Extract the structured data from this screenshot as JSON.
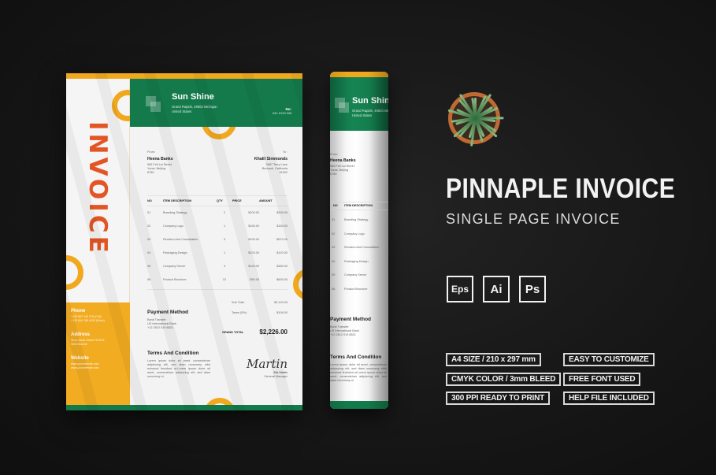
{
  "product": {
    "title": "PINNAPLE INVOICE",
    "subtitle": "SINGLE PAGE INVOICE",
    "file_formats": [
      "Eps",
      "Ai",
      "Ps"
    ],
    "features_left": [
      "A4 SIZE / 210 x 297 mm",
      "CMYK COLOR / 3mm BLEED",
      "300 PPI READY TO PRINT"
    ],
    "features_right": [
      "EASY TO CUSTOMIZE",
      "FREE FONT USED",
      "HELP FILE INCLUDED"
    ]
  },
  "colors": {
    "green": "#147a4c",
    "yellow": "#f2ac22",
    "orange": "#e35524",
    "background": "#161616"
  },
  "invoice": {
    "vertical_title": "INVOICE",
    "company": "Sun Shine",
    "company_address": [
      "Grand Rapids, 49503 Michigan",
      "United States"
    ],
    "invoice_no_label": "No:",
    "invoice_no": "INV. 8749 938",
    "from_label": "From:",
    "from_name": "Heena Banks",
    "from_address": [
      "565 Fell Lai Street",
      "Yunai, Beijing",
      "6780"
    ],
    "to_label": "To :",
    "to_name": "Khalil Simmonds",
    "to_address": [
      "3587 Terry Lane",
      "Burbank, California",
      "91502"
    ],
    "table": {
      "headers": [
        "NO",
        "ITEM DESCRIPTION",
        "QTY",
        "PRICE",
        "AMOUNT"
      ],
      "rows": [
        [
          "01",
          "Branding Strategy",
          "2",
          "$100.00",
          "$200.00"
        ],
        [
          "02",
          "Company Logo",
          "1",
          "$150.00",
          "$150.00"
        ],
        [
          "03",
          "Revision And Consultation",
          "3",
          "$190.00",
          "$570.00"
        ],
        [
          "04",
          "Packaging Design",
          "1",
          "$120.00",
          "$120.00"
        ],
        [
          "05",
          "Company Server",
          "4",
          "$120.00",
          "$480.00"
        ],
        [
          "06",
          "Product Brochure",
          "12",
          "$50.00",
          "$600.00"
        ]
      ]
    },
    "sub_total_label": "Sub Total",
    "sub_total": "$2,120.00",
    "taxes_label": "Taxes (5%)",
    "taxes": "$106.00",
    "grand_total_label": "GRAND TOTAL",
    "grand_total": "$2,226.00",
    "payment_title": "Payment Method",
    "payment_lines": [
      "Bank Transfer",
      "US International Bank",
      "+12 2812 019 8821"
    ],
    "terms_title": "Terms And Condition",
    "terms_text": "Lorem ipsum dolor sit amet, consectetuer adipiscing elit, sed diam nonummy nibh euismod tincidunt ut.Lorem ipsum dolor sit amet, consectetuer adipiscing elit, sed diam nonummy ni",
    "signature_script": "Martin",
    "signer_name": "Zak Martin",
    "signer_title": "General Manager",
    "sidebar": {
      "phone_label": "Phone",
      "phone_lines": [
        "+123 567 142 278 (Cell)",
        "+123 854 788 4432 (Work)"
      ],
      "address_label": "Address",
      "address_lines": [
        "Store Block Street 78 Rd.4",
        "West Bourne"
      ],
      "website_label": "Website",
      "website_lines": [
        "www.yourwebsite.com",
        "www.yourwebsite.com"
      ]
    }
  }
}
